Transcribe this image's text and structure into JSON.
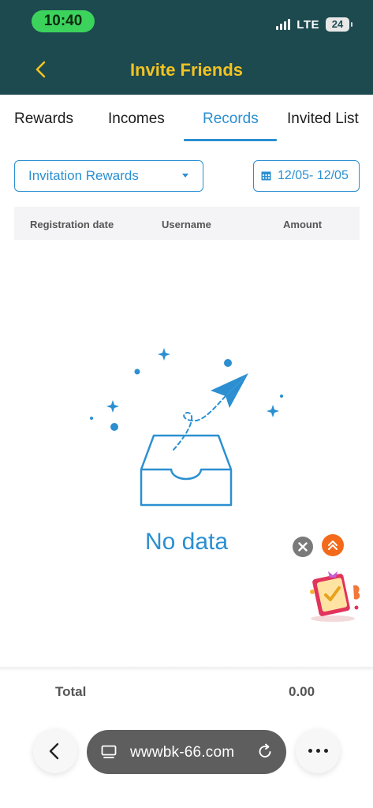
{
  "status_bar": {
    "time": "10:40",
    "network": "LTE",
    "battery": "24"
  },
  "header": {
    "title": "Invite Friends",
    "back_icon": "chevron-left-icon"
  },
  "tabs": [
    {
      "label": "Rewards",
      "active": false
    },
    {
      "label": "Incomes",
      "active": false
    },
    {
      "label": "Records",
      "active": true
    },
    {
      "label": "Invited List",
      "active": false
    }
  ],
  "filters": {
    "type_select": {
      "value": "Invitation Rewards",
      "icon": "chevron-down-icon"
    },
    "date_range": {
      "value": "12/05- 12/05",
      "icon": "calendar-icon"
    }
  },
  "table": {
    "columns": [
      "Registration date",
      "Username",
      "Amount"
    ],
    "rows": []
  },
  "empty_state": {
    "text": "No data",
    "icon": "empty-inbox-paper-plane-icon"
  },
  "floating": {
    "close_icon": "close-icon",
    "up_icon": "double-chevron-up-icon",
    "promo_icon": "gift-book-icon"
  },
  "summary": {
    "label": "Total",
    "value": "0.00"
  },
  "browser": {
    "url": "wwwbk-66.com",
    "back_icon": "chevron-left-icon",
    "more_icon": "more-dots-icon",
    "reload_icon": "reload-icon",
    "page_icon": "page-icon"
  },
  "colors": {
    "header_bg": "#1d4a4f",
    "title": "#f3c321",
    "accent": "#2b8fd1",
    "status_pill": "#3cd35c"
  }
}
